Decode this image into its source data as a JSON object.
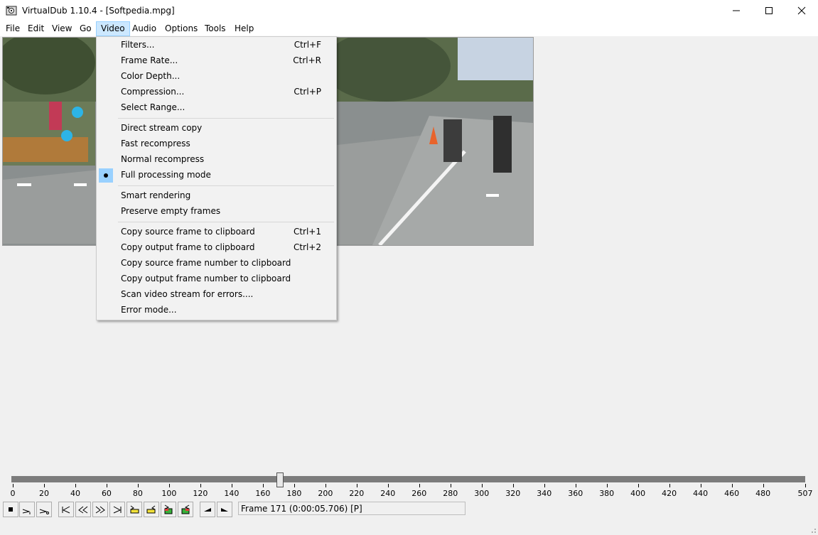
{
  "window": {
    "title": "VirtualDub 1.10.4 - [Softpedia.mpg]",
    "controls": [
      "minimize",
      "maximize",
      "close"
    ]
  },
  "menubar": {
    "items": [
      {
        "label": "File"
      },
      {
        "label": "Edit"
      },
      {
        "label": "View"
      },
      {
        "label": "Go"
      },
      {
        "label": "Video",
        "active": true
      },
      {
        "label": "Audio"
      },
      {
        "label": "Options"
      },
      {
        "label": "Tools"
      },
      {
        "label": "Help"
      }
    ]
  },
  "video_menu": {
    "items": [
      {
        "label": "Filters...",
        "shortcut": "Ctrl+F"
      },
      {
        "label": "Frame Rate...",
        "shortcut": "Ctrl+R"
      },
      {
        "label": "Color Depth...",
        "shortcut": ""
      },
      {
        "label": "Compression...",
        "shortcut": "Ctrl+P"
      },
      {
        "label": "Select Range...",
        "shortcut": ""
      },
      {
        "label": "Direct stream copy",
        "shortcut": ""
      },
      {
        "label": "Fast recompress",
        "shortcut": ""
      },
      {
        "label": "Normal recompress",
        "shortcut": ""
      },
      {
        "label": "Full processing mode",
        "shortcut": "",
        "checked": true
      },
      {
        "label": "Smart rendering",
        "shortcut": ""
      },
      {
        "label": "Preserve empty frames",
        "shortcut": ""
      },
      {
        "label": "Copy source frame to clipboard",
        "shortcut": "Ctrl+1"
      },
      {
        "label": "Copy output frame to clipboard",
        "shortcut": "Ctrl+2"
      },
      {
        "label": "Copy source frame number to clipboard",
        "shortcut": ""
      },
      {
        "label": "Copy output frame number to clipboard",
        "shortcut": ""
      },
      {
        "label": "Scan video stream for errors....",
        "shortcut": ""
      },
      {
        "label": "Error mode...",
        "shortcut": ""
      }
    ]
  },
  "timeline": {
    "min": 0,
    "max": 507,
    "current": 171,
    "labels": [
      "0",
      "20",
      "40",
      "60",
      "80",
      "100",
      "120",
      "140",
      "160",
      "180",
      "200",
      "220",
      "240",
      "260",
      "280",
      "300",
      "320",
      "340",
      "360",
      "380",
      "400",
      "420",
      "440",
      "460",
      "480",
      "507"
    ]
  },
  "toolbar": {
    "buttons": [
      "stop",
      "play-input",
      "play-output",
      "go-start",
      "prev-frame",
      "next-frame",
      "go-end",
      "prev-keyframe",
      "next-keyframe",
      "scene-back",
      "scene-forward",
      "mark-in",
      "mark-out"
    ]
  },
  "status": {
    "frame_info": "Frame 171 (0:00:05.706) [P]"
  }
}
